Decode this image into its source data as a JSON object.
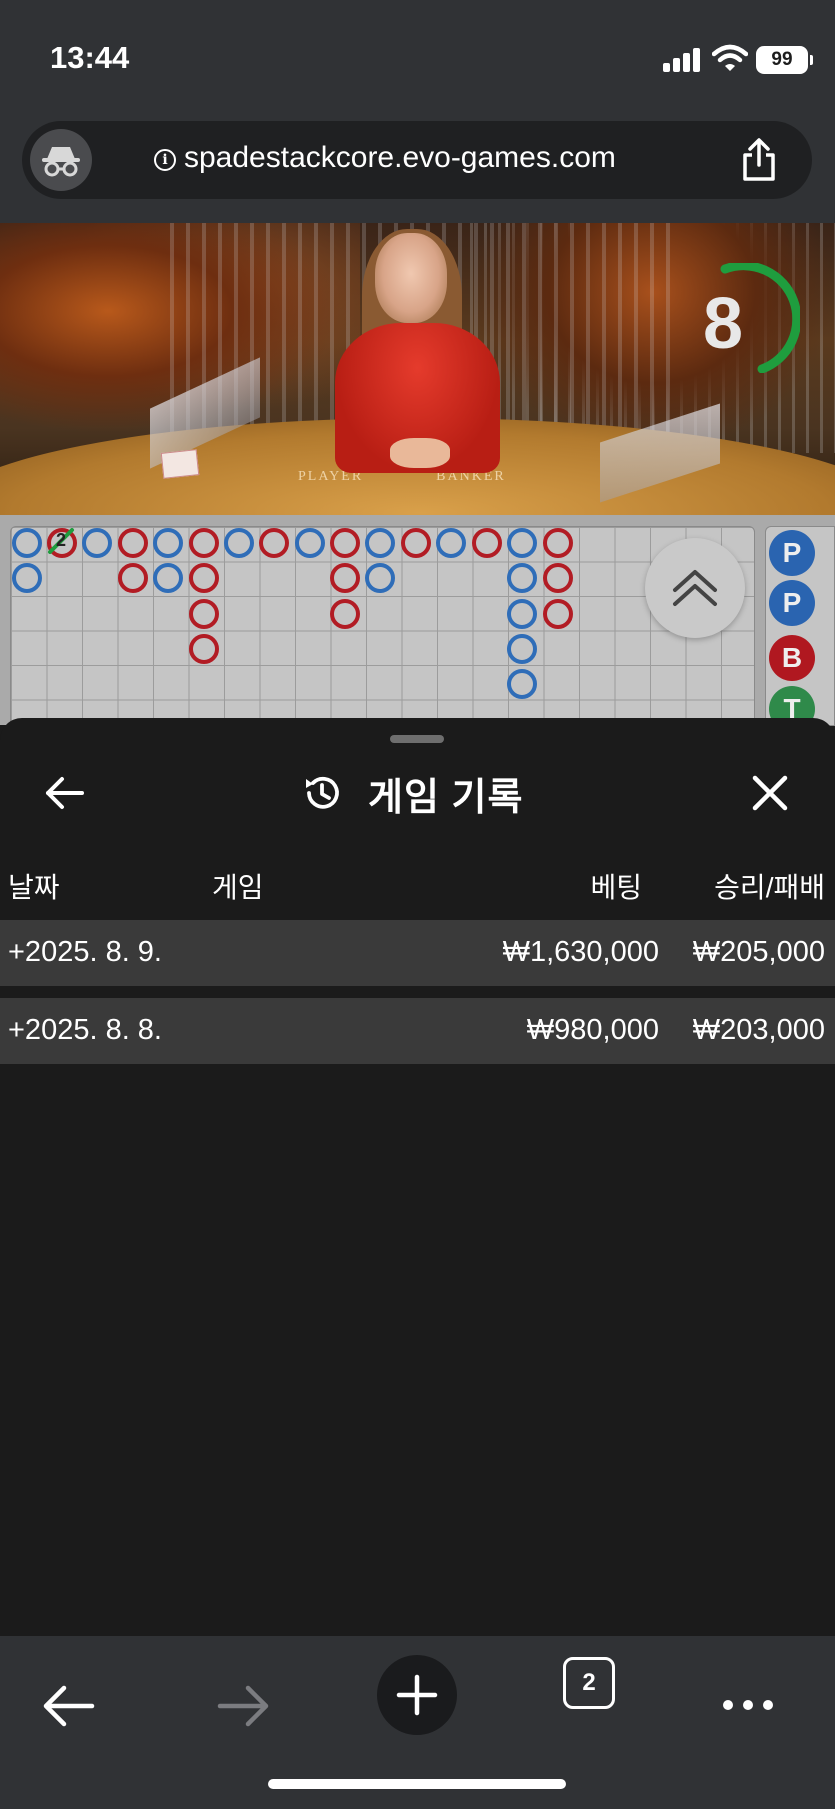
{
  "status_bar": {
    "time": "13:44",
    "battery": "99",
    "icons": [
      "signal-icon",
      "wifi-icon",
      "battery-icon"
    ]
  },
  "address_bar": {
    "url": "spadestackcore.evo-games.com",
    "info_glyph": "i",
    "icons": [
      "incognito-icon",
      "info-icon",
      "share-icon"
    ]
  },
  "video": {
    "table_left_label": "PLAYER",
    "table_right_label": "BANKER",
    "timer_value": "8"
  },
  "roadmap": {
    "bead_number": "2",
    "side_chips": [
      "P",
      "P",
      "B",
      "T"
    ],
    "icons": [
      "expand-up-icon"
    ]
  },
  "history_panel": {
    "title": "게임 기록",
    "columns": {
      "date": "날짜",
      "game": "게임",
      "bet": "베팅",
      "win_loss": "승리/패배"
    },
    "rows": [
      {
        "date": "+2025. 8. 9.",
        "bet": "₩1,630,000",
        "win_loss": "₩205,000"
      },
      {
        "date": "+2025. 8. 8.",
        "bet": "₩980,000",
        "win_loss": "₩203,000"
      }
    ],
    "icons": [
      "back-arrow-icon",
      "history-icon",
      "close-icon"
    ]
  },
  "toolbar": {
    "tab_count": "2",
    "icons": [
      "back-icon",
      "forward-icon",
      "plus-icon",
      "tabs-icon",
      "more-icon"
    ]
  },
  "colors": {
    "player": "#2f6db8",
    "banker": "#b21c24",
    "tie": "#2f8a4a",
    "timer_arc": "#1f9d3e",
    "panel_bg": "#1b1b1b",
    "row_bg": "#3a3a3a",
    "chrome_bg": "#303235"
  }
}
